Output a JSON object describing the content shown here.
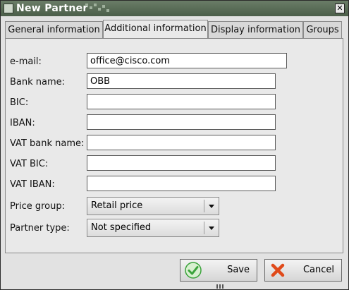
{
  "window": {
    "title": "New Partner",
    "close_glyph": "✕",
    "title_icon": "window-menu-icon"
  },
  "tabs": [
    {
      "label": "General information",
      "active": false
    },
    {
      "label": "Additional information",
      "active": true
    },
    {
      "label": "Display information",
      "active": false
    },
    {
      "label": "Groups",
      "active": false
    }
  ],
  "form": {
    "email": {
      "label": "e-mail:",
      "value": "office@cisco.com"
    },
    "bank_name": {
      "label": "Bank name:",
      "value": "OBB"
    },
    "bic": {
      "label": "BIC:",
      "value": ""
    },
    "iban": {
      "label": "IBAN:",
      "value": ""
    },
    "vat_bank_name": {
      "label": "VAT bank name:",
      "value": ""
    },
    "vat_bic": {
      "label": "VAT BIC:",
      "value": ""
    },
    "vat_iban": {
      "label": "VAT IBAN:",
      "value": ""
    },
    "price_group": {
      "label": "Price group:",
      "value": "Retail price"
    },
    "partner_type": {
      "label": "Partner type:",
      "value": "Not specified"
    }
  },
  "buttons": {
    "save": {
      "label": "Save",
      "icon": "checkmark-icon",
      "color": "#3aa33a"
    },
    "cancel": {
      "label": "Cancel",
      "icon": "x-cross-icon",
      "color": "#e04a1a"
    }
  }
}
